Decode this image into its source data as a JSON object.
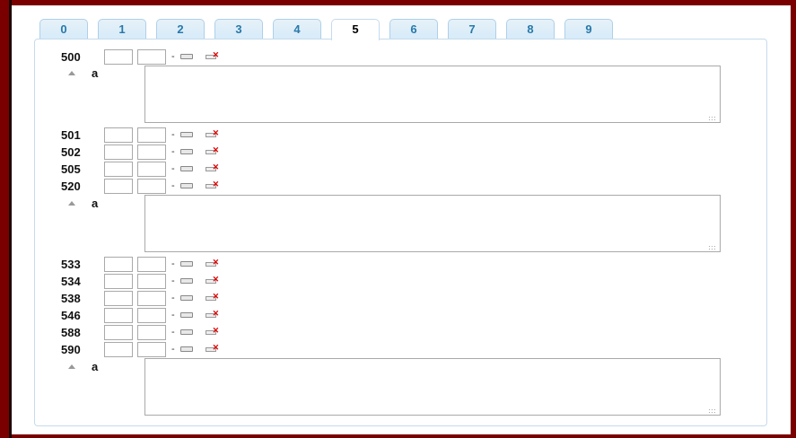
{
  "tabs": [
    {
      "label": "0",
      "active": false
    },
    {
      "label": "1",
      "active": false
    },
    {
      "label": "2",
      "active": false
    },
    {
      "label": "3",
      "active": false
    },
    {
      "label": "4",
      "active": false
    },
    {
      "label": "5",
      "active": true
    },
    {
      "label": "6",
      "active": false
    },
    {
      "label": "7",
      "active": false
    },
    {
      "label": "8",
      "active": false
    },
    {
      "label": "9",
      "active": false
    }
  ],
  "fields": [
    {
      "tag": "500",
      "dash": "-",
      "subfield": {
        "code": "a"
      }
    },
    {
      "tag": "501",
      "dash": "-"
    },
    {
      "tag": "502",
      "dash": "-"
    },
    {
      "tag": "505",
      "dash": "-"
    },
    {
      "tag": "520",
      "dash": "-",
      "subfield": {
        "code": "a"
      }
    },
    {
      "tag": "533",
      "dash": "-"
    },
    {
      "tag": "534",
      "dash": "-"
    },
    {
      "tag": "538",
      "dash": "-"
    },
    {
      "tag": "546",
      "dash": "-"
    },
    {
      "tag": "588",
      "dash": "-"
    },
    {
      "tag": "590",
      "dash": "-",
      "subfield": {
        "code": "a"
      }
    }
  ],
  "icons": {
    "edit": "edit-field-icon",
    "delete": "delete-field-icon",
    "collapse": "collapse-arrow-icon"
  },
  "colors": {
    "frame": "#7a0000",
    "tab_text": "#2779aa",
    "delete_x": "#dd0000"
  }
}
